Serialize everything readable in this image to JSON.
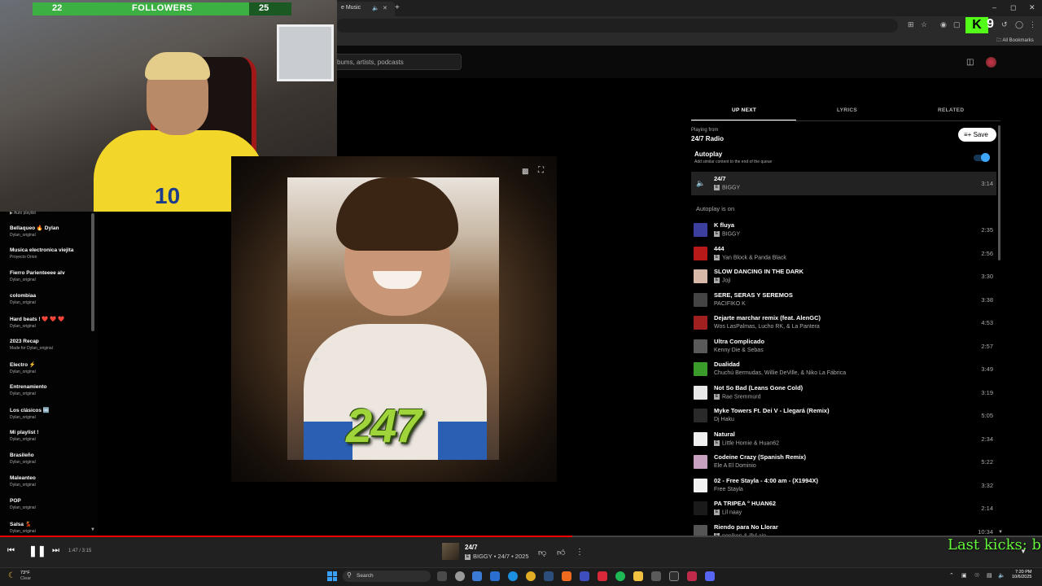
{
  "browser": {
    "active_tab_title": "e Music",
    "bookmarks_label": "All Bookmarks"
  },
  "overlay": {
    "followers_left": "22",
    "followers_label": "FOLLOWERS",
    "followers_right": "25",
    "followers_progress": 0.88,
    "webcam_shirt_number": "10",
    "kick_counter": "9",
    "ticker_text": "Last kicks: bar"
  },
  "ytm": {
    "search_placeholder": "bums, artists, podcasts"
  },
  "sidebar": {
    "header_sub": "Auto playlist",
    "playlists": [
      {
        "title": "Bellaqueo 🔥 Dylan",
        "sub": "Dylan_original"
      },
      {
        "title": "Musica electronica viejita",
        "sub": "Proyecto Orion"
      },
      {
        "title": "Fierro Parienteeee alv",
        "sub": "Dylan_original"
      },
      {
        "title": "colombiaa",
        "sub": "Dylan_original"
      },
      {
        "title": "Hard beats ! ❤️ ❤️ ❤️",
        "sub": "Dylan_original"
      },
      {
        "title": "2023 Recap",
        "sub": "Made for Dylan_original"
      },
      {
        "title": "Electro ⚡",
        "sub": "Dylan_original"
      },
      {
        "title": "Entrenamiento",
        "sub": "Dylan_original"
      },
      {
        "title": "Los clásicos 🆒",
        "sub": "Dylan_original"
      },
      {
        "title": "Mi playlist !",
        "sub": "Dylan_original"
      },
      {
        "title": "Brasileño",
        "sub": "Dylan_original"
      },
      {
        "title": "Maleanteo",
        "sub": "Dylan_original"
      },
      {
        "title": "POP",
        "sub": "Dylan_original"
      },
      {
        "title": "Salsa 💃",
        "sub": "Dylan_original"
      }
    ]
  },
  "album_art": {
    "text": "247"
  },
  "panel": {
    "tabs": [
      "UP NEXT",
      "LYRICS",
      "RELATED"
    ],
    "playing_from_label": "Playing from",
    "playing_from_title": "24/7 Radio",
    "save_label": "Save",
    "autoplay_label": "Autoplay",
    "autoplay_desc": "Add similar content to the end of the queue",
    "autoplay_on": true,
    "current": {
      "title": "24/7",
      "artist": "BIGGY",
      "duration": "3:14",
      "explicit": true
    },
    "autoplay_status": "Autoplay is on",
    "queue": [
      {
        "title": "K fluya",
        "artist": "BIGGY",
        "duration": "2:35",
        "explicit": true,
        "color": "#3c3f9e"
      },
      {
        "title": "444",
        "artist": "Yan Block & Panda Black",
        "duration": "2:56",
        "explicit": true,
        "color": "#b71818"
      },
      {
        "title": "SLOW DANCING IN THE DARK",
        "artist": "Joji",
        "duration": "3:30",
        "explicit": true,
        "color": "#d8b8a8"
      },
      {
        "title": "SERE, SERAS Y SEREMOS",
        "artist": "PACIFIKO K",
        "duration": "3:38",
        "explicit": false,
        "color": "#444444"
      },
      {
        "title": "Dejarte marchar remix (feat. AlenGC)",
        "artist": "Wos LasPalmas, Lucho RK, & La Pantera",
        "duration": "4:53",
        "explicit": false,
        "color": "#a02020"
      },
      {
        "title": "Ultra Complicado",
        "artist": "Kenny Die & Sebas",
        "duration": "2:57",
        "explicit": false,
        "color": "#5a5a5a"
      },
      {
        "title": "Dualidad",
        "artist": "Chuchú Bermudas, Willie DeVille, & Niko La Fábrica",
        "duration": "3:49",
        "explicit": false,
        "color": "#3a9a2a"
      },
      {
        "title": "Not So Bad (Leans Gone Cold)",
        "artist": "Rae Sremmurd",
        "duration": "3:19",
        "explicit": true,
        "color": "#e8e8e8"
      },
      {
        "title": "Myke Towers Ft. Dei V - Llegará (Remix)",
        "artist": "Dj Haku",
        "duration": "5:05",
        "explicit": false,
        "color": "#2a2a2a"
      },
      {
        "title": "Natural",
        "artist": "Little Homie & Huan62",
        "duration": "2:34",
        "explicit": true,
        "color": "#f0f0f0"
      },
      {
        "title": "Codeine Crazy (Spanish Remix)",
        "artist": "Ele A El Dominio",
        "duration": "5:22",
        "explicit": false,
        "color": "#c8a0c0"
      },
      {
        "title": "02 - Free Stayla - 4:00 am - (X1994X)",
        "artist": "Free Stayla",
        "duration": "3:32",
        "explicit": false,
        "color": "#f2f2f2"
      },
      {
        "title": "PA TRIPEA ° HUAN62",
        "artist": "Lil naay",
        "duration": "2:14",
        "explicit": true,
        "color": "#1a1a1a"
      },
      {
        "title": "Riendo para No Llorar",
        "artist": "nonikon & illyl ain",
        "duration": "10:34",
        "explicit": true,
        "color": "#555555"
      }
    ]
  },
  "player": {
    "time": "1:47 / 3:15",
    "progress": 0.549,
    "title": "24/7",
    "subtitle": "BIGGY • 24/7 • 2025",
    "explicit": true
  },
  "taskbar": {
    "weather_temp": "73°F",
    "weather_desc": "Clear",
    "search_label": "Search",
    "time": "7:20 PM",
    "date": "10/6/2025"
  },
  "colors": {
    "accent_red": "#ff0000",
    "toggle_blue": "#3ea6ff",
    "kick_green": "#53fc18"
  }
}
